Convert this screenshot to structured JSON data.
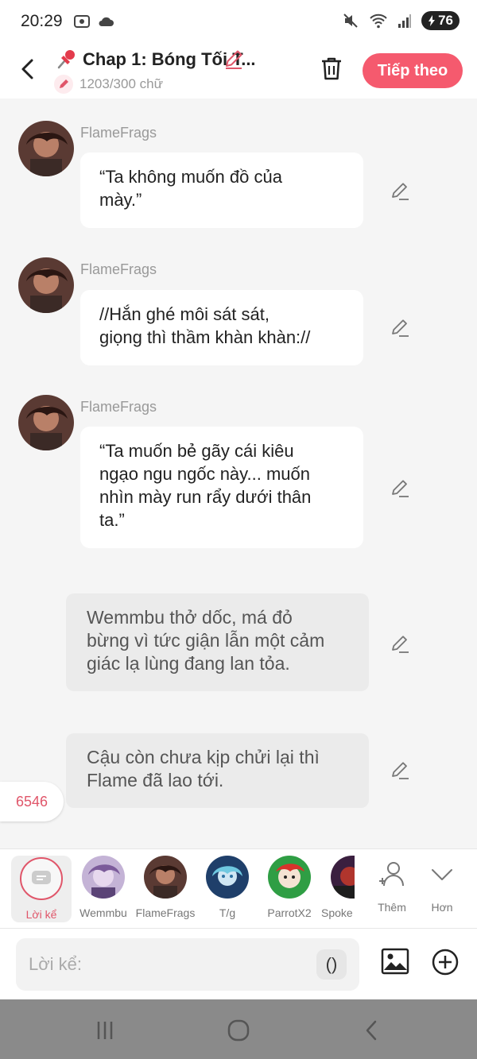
{
  "status_bar": {
    "time": "20:29",
    "battery": "76",
    "icons": [
      "screenshot-icon",
      "cloud-icon",
      "mute-icon",
      "wifi-icon",
      "signal-icon",
      "battery-icon"
    ]
  },
  "header": {
    "title": "Chap 1: Bóng Tối T...",
    "word_count": "1203/300 chữ",
    "next_label": "Tiếp theo"
  },
  "messages": [
    {
      "sender": "FlameFrags",
      "lines": [
        "“Ta không muốn đồ của",
        "mày.”"
      ]
    },
    {
      "sender": "FlameFrags",
      "lines": [
        "//Hắn ghé môi sát sát,",
        "giọng thì thầm khàn khàn://"
      ]
    },
    {
      "sender": "FlameFrags",
      "lines": [
        "“Ta muốn bẻ gãy cái kiêu",
        "ngạo ngu ngốc này... muốn",
        "nhìn mày run rẩy dưới thân",
        "ta.”"
      ]
    }
  ],
  "narrations": [
    {
      "lines": [
        "Wemmbu thở dốc, má đỏ",
        "bừng vì tức giận lẫn một cảm",
        "giác lạ lùng đang lan tỏa."
      ]
    },
    {
      "lines": [
        "Cậu còn chưa kịp chửi lại thì",
        "Flame đã lao tới."
      ]
    }
  ],
  "counter": "6546",
  "characters": [
    {
      "label": "Lời kể",
      "selected": true
    },
    {
      "label": "Wemmbu"
    },
    {
      "label": "FlameFrags"
    },
    {
      "label": "T/g"
    },
    {
      "label": "ParrotX2"
    },
    {
      "label": "Spoke"
    }
  ],
  "tools": {
    "add_label": "Thêm",
    "more_label": "Hơn"
  },
  "input": {
    "placeholder": "Lời kể:",
    "paren": "()"
  },
  "colors": {
    "accent": "#f55a6e",
    "accent_text": "#e0566a",
    "background": "#f5f5f5",
    "narration": "#ebebeb"
  }
}
